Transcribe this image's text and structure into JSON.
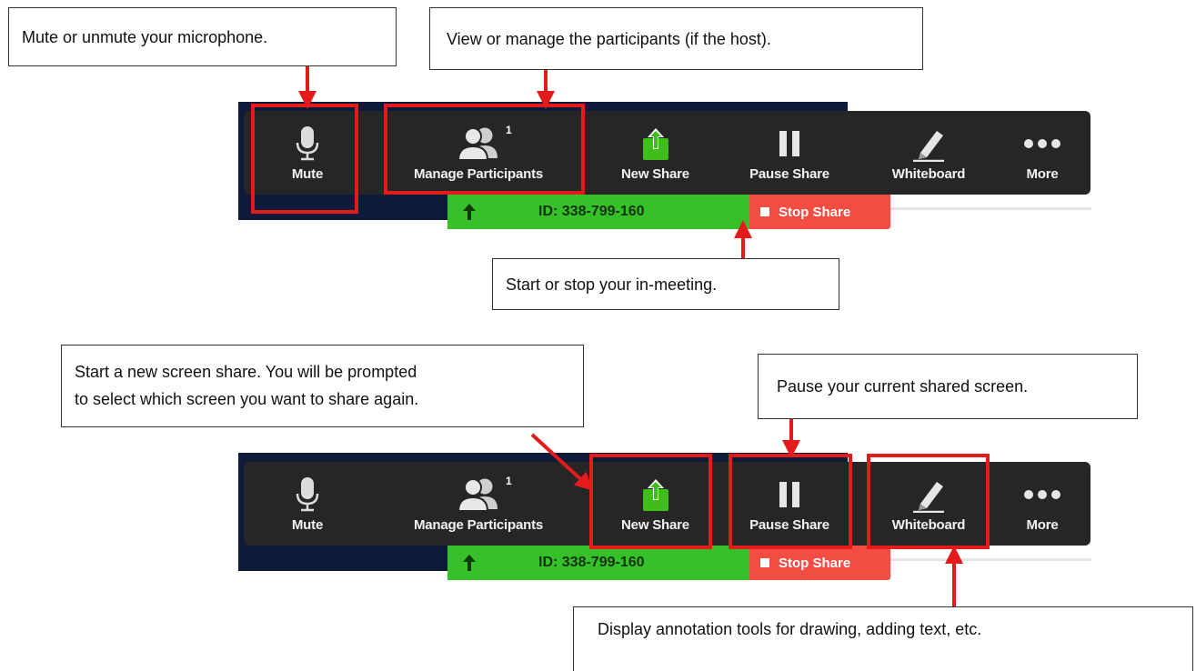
{
  "callouts": {
    "mute": "Mute or unmute your microphone.",
    "participants": "View or manage the participants (if the host).",
    "meeting": "Start or stop your in-meeting.",
    "new_share": [
      "Start a new screen share. You will be prompted",
      "to select which screen you want to share again."
    ],
    "pause": "Pause your current shared screen.",
    "annotate": "Display annotation tools for drawing, adding text, etc."
  },
  "toolbar": {
    "mute_label": "Mute",
    "participants_label": "Manage Participants",
    "participants_count": "1",
    "new_share_label": "New Share",
    "pause_share_label": "Pause Share",
    "whiteboard_label": "Whiteboard",
    "more_label": "More"
  },
  "status": {
    "meeting_id": "ID: 338-799-160",
    "stop_share_label": "Stop Share"
  },
  "icons": [
    "microphone-icon",
    "participants-icon",
    "share-screen-icon",
    "pause-icon",
    "pencil-icon",
    "more-dots-icon",
    "arrow-icon"
  ],
  "colors": {
    "toolbar": "#262626",
    "id_bar": "#36c02a",
    "stop_share": "#f24c43",
    "highlight": "#e31b1b",
    "share_icon": "#3fbd1b"
  }
}
